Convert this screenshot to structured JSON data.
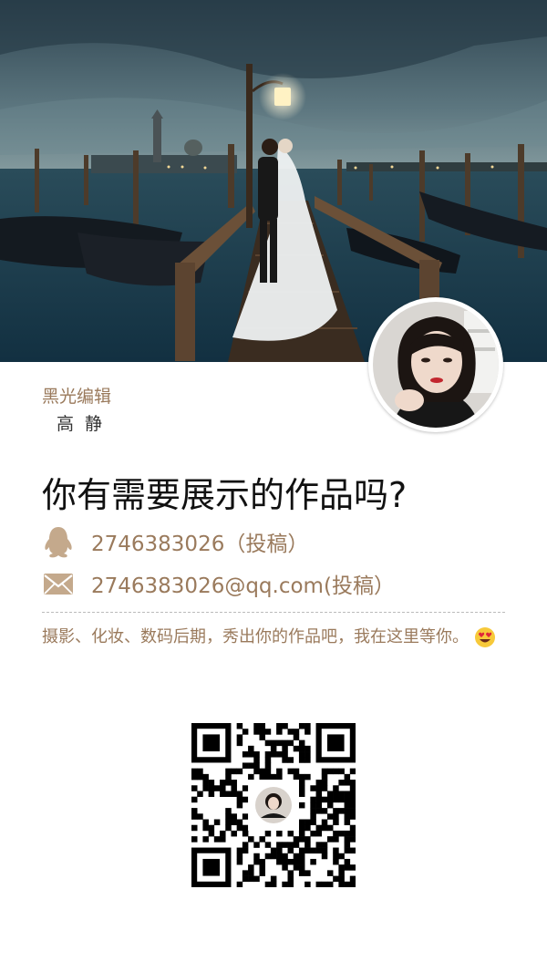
{
  "header": {
    "photo": "wedding-venice-photo",
    "avatar": "editor-avatar"
  },
  "profile": {
    "brand": "黑光编辑",
    "author": "高 静"
  },
  "headline": "你有需要展示的作品吗?",
  "contacts": {
    "qq": {
      "icon": "qq-penguin-icon",
      "text": "2746383026（投稿）"
    },
    "email": {
      "icon": "mail-envelope-icon",
      "text": "2746383026@qq.com(投稿）"
    }
  },
  "description": "摄影、化妆、数码后期，秀出你的作品吧，我在这里等你。",
  "emoji": "heart-eyes-emoji",
  "qr": "wechat-qr-code",
  "colors": {
    "accent": "#9a7a5c",
    "icon": "#c4a98c",
    "text": "#111111"
  }
}
